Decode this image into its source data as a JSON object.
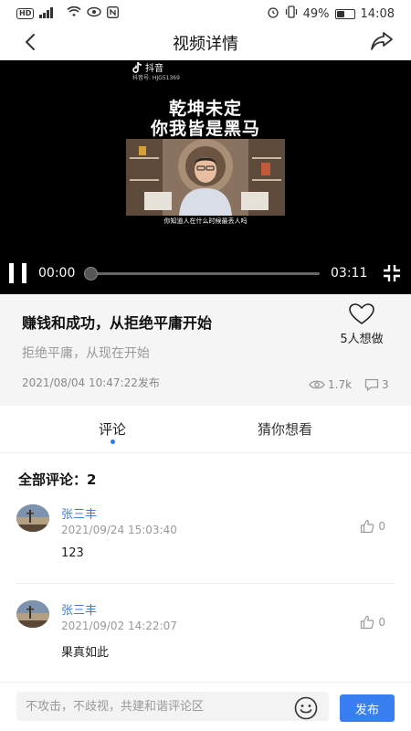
{
  "status_bar": {
    "left_badge": "HD",
    "left_signal": "⁴ᴳ.ıl",
    "battery": "49%",
    "battery_level": 0.49,
    "time": "14:08"
  },
  "nav": {
    "title": "视频详情",
    "back_icon": "chevron-left-icon",
    "share_icon": "share-arrow-icon"
  },
  "video": {
    "brand": "抖音",
    "brand_id": "抖音号: HJG51369",
    "overlay_line1": "乾坤未定",
    "overlay_line2": "你我皆是黑马",
    "subtitle": "你知道人在什么时候最丢人吗",
    "current_time": "00:00",
    "duration": "03:11",
    "progress": 0.0
  },
  "info": {
    "title": "赚钱和成功，从拒绝平庸开始",
    "subtitle": "拒绝平庸，从现在开始",
    "published": "2021/08/04 10:47:22发布",
    "want_count": "5人想做",
    "views": "1.7k",
    "comment_count": "3"
  },
  "tabs": [
    {
      "label": "评论",
      "active": true
    },
    {
      "label": "猜你想看",
      "active": false
    }
  ],
  "comments_header": "全部评论：2",
  "comments": [
    {
      "name": "张三丰",
      "date": "2021/09/24 15:03:40",
      "text": "123",
      "likes": "0"
    },
    {
      "name": "张三丰",
      "date": "2021/09/02 14:22:07",
      "text": "果真如此",
      "likes": "0"
    }
  ],
  "composer": {
    "placeholder": "不攻击，不歧视，共建和谐评论区",
    "emoji_icon": "emoji-smile-icon",
    "publish_label": "发布"
  },
  "colors": {
    "accent": "#3a7ff2",
    "name_link": "#3d7fd6",
    "tab_dot": "#2979ff"
  }
}
